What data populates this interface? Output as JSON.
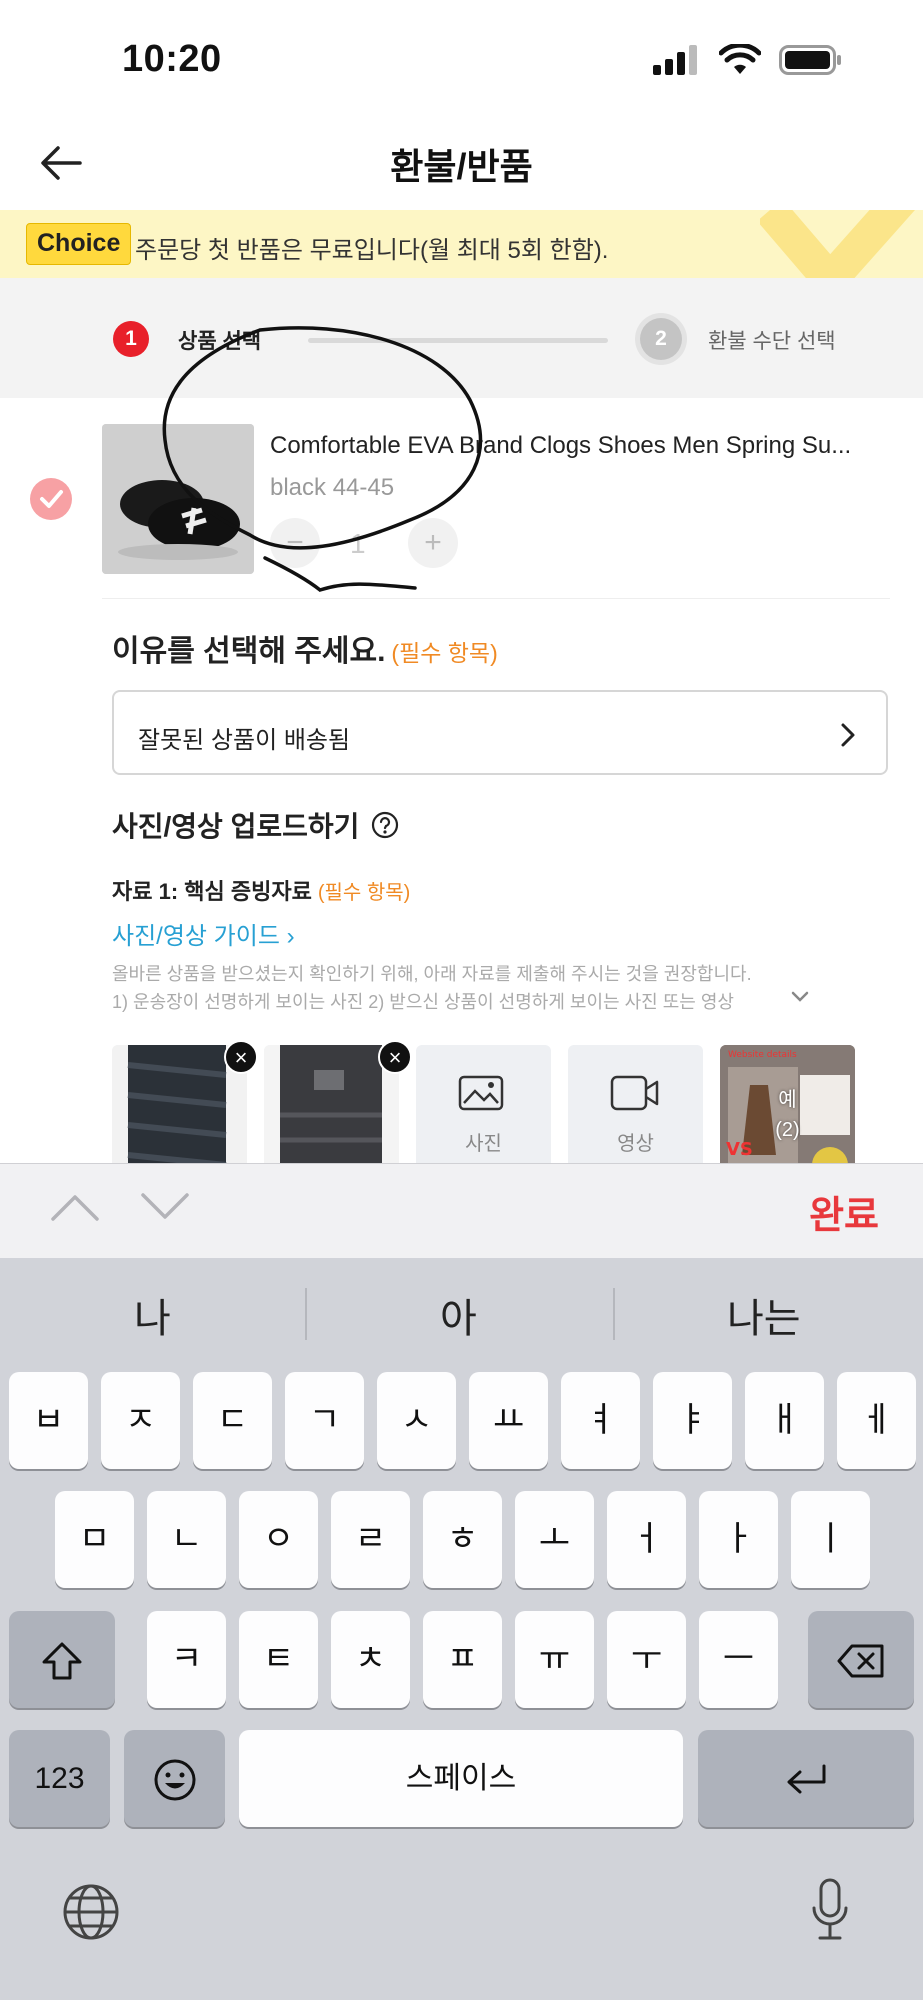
{
  "status_bar": {
    "time": "10:20"
  },
  "nav": {
    "title": "환불/반품"
  },
  "banner": {
    "badge": "Choice",
    "text": "주문당 첫 반품은 무료입니다(월 최대 5회 한함)."
  },
  "stepper": {
    "steps": [
      {
        "number": "1",
        "label": "상품 선택"
      },
      {
        "number": "2",
        "label": "환불 수단 선택"
      }
    ]
  },
  "product": {
    "title": "Comfortable EVA Brand Clogs Shoes Men Spring Su...",
    "variant": "black 44-45",
    "quantity": "1",
    "minus": "−",
    "plus": "+"
  },
  "reason": {
    "title": "이유를 선택해 주세요.",
    "required": "(필수 항목)",
    "selected": "잘못된 상품이 배송됨"
  },
  "upload": {
    "title": "사진/영상 업로드하기",
    "evidence_label": "자료 1: 핵심 증빙자료",
    "evidence_required": "(필수 항목)",
    "guide_link": "사진/영상 가이드 ›",
    "desc_line1": "올바른 상품을 받으셨는지 확인하기 위해, 아래 자료를 제출해 주시는 것을 권장합니다.",
    "desc_line2": "1) 운송장이 선명하게 보이는 사진 2) 받으신 상품이 선명하게 보이는 사진 또는 영상",
    "photo_button": "사진",
    "video_button": "영상",
    "example_label": "예",
    "example_count": "(2)"
  },
  "keyboard_toolbar": {
    "done": "완료"
  },
  "keyboard": {
    "suggestions": [
      "나",
      "아",
      "나는"
    ],
    "row1": [
      "ㅂ",
      "ㅈ",
      "ㄷ",
      "ㄱ",
      "ㅅ",
      "ㅛ",
      "ㅕ",
      "ㅑ",
      "ㅐ",
      "ㅔ"
    ],
    "row2": [
      "ㅁ",
      "ㄴ",
      "ㅇ",
      "ㄹ",
      "ㅎ",
      "ㅗ",
      "ㅓ",
      "ㅏ",
      "ㅣ"
    ],
    "row3": [
      "ㅋ",
      "ㅌ",
      "ㅊ",
      "ㅍ",
      "ㅠ",
      "ㅜ",
      "ㅡ"
    ],
    "numbers_key": "123",
    "space_key": "스페이스"
  },
  "colors": {
    "accent_red": "#e8202a",
    "done_red": "#e8383c",
    "required_orange": "#f08a24",
    "link_blue": "#27a0d3",
    "banner_bg": "#fdf6c5"
  }
}
